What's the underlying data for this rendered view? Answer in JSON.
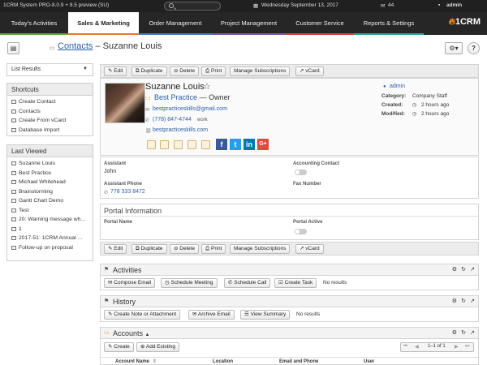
{
  "topbar": {
    "system": "1CRM System PRO-8.0.9 + 8.5 preview (SU)",
    "date": "Wednesday September 13, 2017",
    "mail_count": "44",
    "user": "admin"
  },
  "tabs": [
    "Today's Activities",
    "Sales & Marketing",
    "Order Management",
    "Project Management",
    "Customer Service",
    "Reports & Settings"
  ],
  "tab_colors": [
    "#5aa832",
    "#e2792b",
    "#3c7dc4",
    "#7a54b5",
    "#d33c3c",
    "#2aa69d"
  ],
  "logo": "1CRM",
  "breadcrumb": {
    "module": "Contacts",
    "sep": " – ",
    "record": "Suzanne Louis"
  },
  "sidebar": {
    "list_results": "List Results",
    "shortcuts_title": "Shortcuts",
    "shortcuts": [
      "Create Contact",
      "Contacts",
      "Create From vCard",
      "Database Import"
    ],
    "last_viewed_title": "Last Viewed",
    "last_viewed": [
      "Suzanne Louis",
      "Best Practice",
      "Michael Whitehead",
      "Brainstorming",
      "Gantt Chart Demo",
      "Test",
      "20: Warning message wh...",
      "1",
      "2017-51: 1CRM Annual ...",
      "Follow-up on proposal"
    ]
  },
  "toolbar": {
    "edit": "Edit",
    "duplicate": "Duplicate",
    "delete": "Delete",
    "print": "Print",
    "manage_subscriptions": "Manage Subscriptions",
    "vcard": "vCard"
  },
  "contact": {
    "name": "Suzanne Louis",
    "company": "Best Practice",
    "title_sep": "—",
    "role": "Owner",
    "email": "bestpracticeskills@gmail.com",
    "phone": "(778) 847-4744",
    "phone_type": "work",
    "website": "bestpracticeskills.com",
    "assigned_user": "admin",
    "category_label": "Category:",
    "category": "Company Staff",
    "created_label": "Created:",
    "created": "2 hours ago",
    "modified_label": "Modified:",
    "modified": "2 hours ago"
  },
  "details": {
    "assistant_label": "Assistant",
    "assistant": "John",
    "accounting_contact_label": "Accounting Contact",
    "assistant_phone_label": "Assistant Phone",
    "assistant_phone": "778 333 8472",
    "fax_label": "Fax Number"
  },
  "portal": {
    "title": "Portal Information",
    "name_label": "Portal Name",
    "active_label": "Portal Active"
  },
  "activities": {
    "title": "Activities",
    "compose": "Compose Email",
    "schedule_meeting": "Schedule Meeting",
    "schedule_call": "Schedule Call",
    "create_task": "Create Task",
    "empty": "No results"
  },
  "history": {
    "title": "History",
    "create_note": "Create Note or Attachment",
    "archive_email": "Archive Email",
    "view_summary": "View Summary",
    "empty": "No results"
  },
  "accounts": {
    "title": "Accounts",
    "create": "Create",
    "add_existing": "Add Existing",
    "pager": "1–1 of 1",
    "columns": [
      "Account Name",
      "Location",
      "Email and Phone",
      "User"
    ]
  }
}
